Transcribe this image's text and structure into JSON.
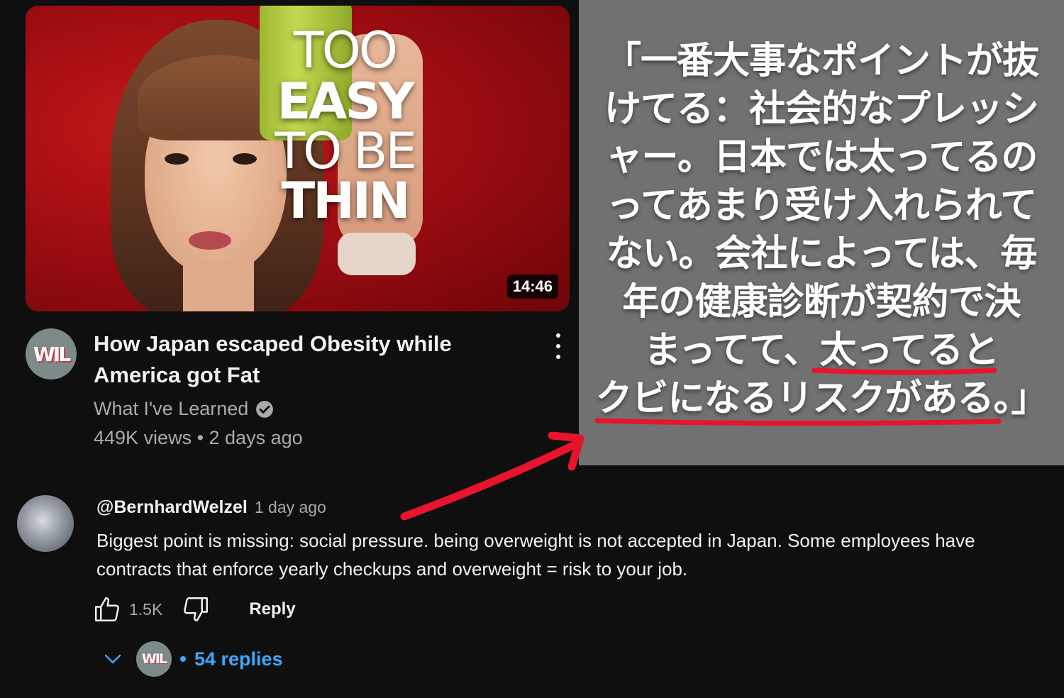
{
  "video": {
    "thumbnail_text": {
      "line1": "TOO",
      "line2": "EASY",
      "line3": "TO BE",
      "line4": "THIN"
    },
    "duration": "14:46",
    "title": "How Japan escaped Obesity while America got Fat",
    "channel": {
      "avatar_text": "WIL",
      "name": "What I've Learned",
      "verified": true
    },
    "stats": "449K views • 2 days ago"
  },
  "translation_panel": {
    "lines": [
      "「一番大事なポイントが抜",
      "けてる：社会的なプレッシ",
      "ャー。日本では太ってるの",
      "ってあまり受け入れられて",
      "ない。会社によっては、毎",
      "年の健康診断が契約で決",
      "まってて、太ってると",
      "クビになるリスクがある。」"
    ],
    "highlight_color": "#e8142e"
  },
  "comment": {
    "author": "@BernhardWelzel",
    "time": "1 day ago",
    "body": "Biggest point is missing: social pressure. being overweight is not accepted in Japan. Some employees have contracts that enforce yearly checkups and overweight = risk to your job.",
    "like_count": "1.5K",
    "reply_label": "Reply",
    "replies": {
      "avatar_text": "WIL",
      "label": "54 replies"
    }
  },
  "colors": {
    "background": "#0f0f0f",
    "panel": "#717171",
    "link": "#3ea6ff",
    "arrow": "#e8142e"
  }
}
